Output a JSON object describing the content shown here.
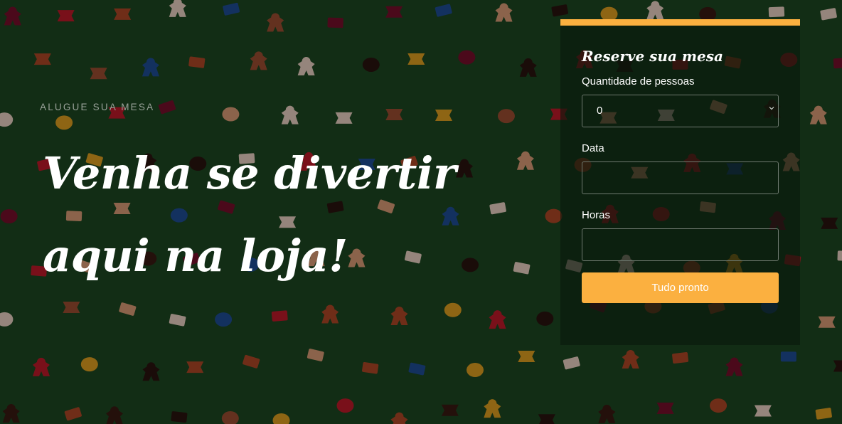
{
  "hero": {
    "eyebrow": "ALUGUE SUA MESA",
    "headline_line1": "Venha se divertir",
    "headline_line2": "aqui na loja!",
    "background": "board-game-meeples-on-green-felt"
  },
  "reservation": {
    "title": "Reserve sua mesa",
    "people_label": "Quantidade de pessoas",
    "people_value": "0",
    "date_label": "Data",
    "date_value": "",
    "hours_label": "Horas",
    "hours_value": "",
    "submit_label": "Tudo pronto"
  },
  "colors": {
    "accent": "#fbb040",
    "background_green": "#1d4a22",
    "text": "#ffffff"
  }
}
